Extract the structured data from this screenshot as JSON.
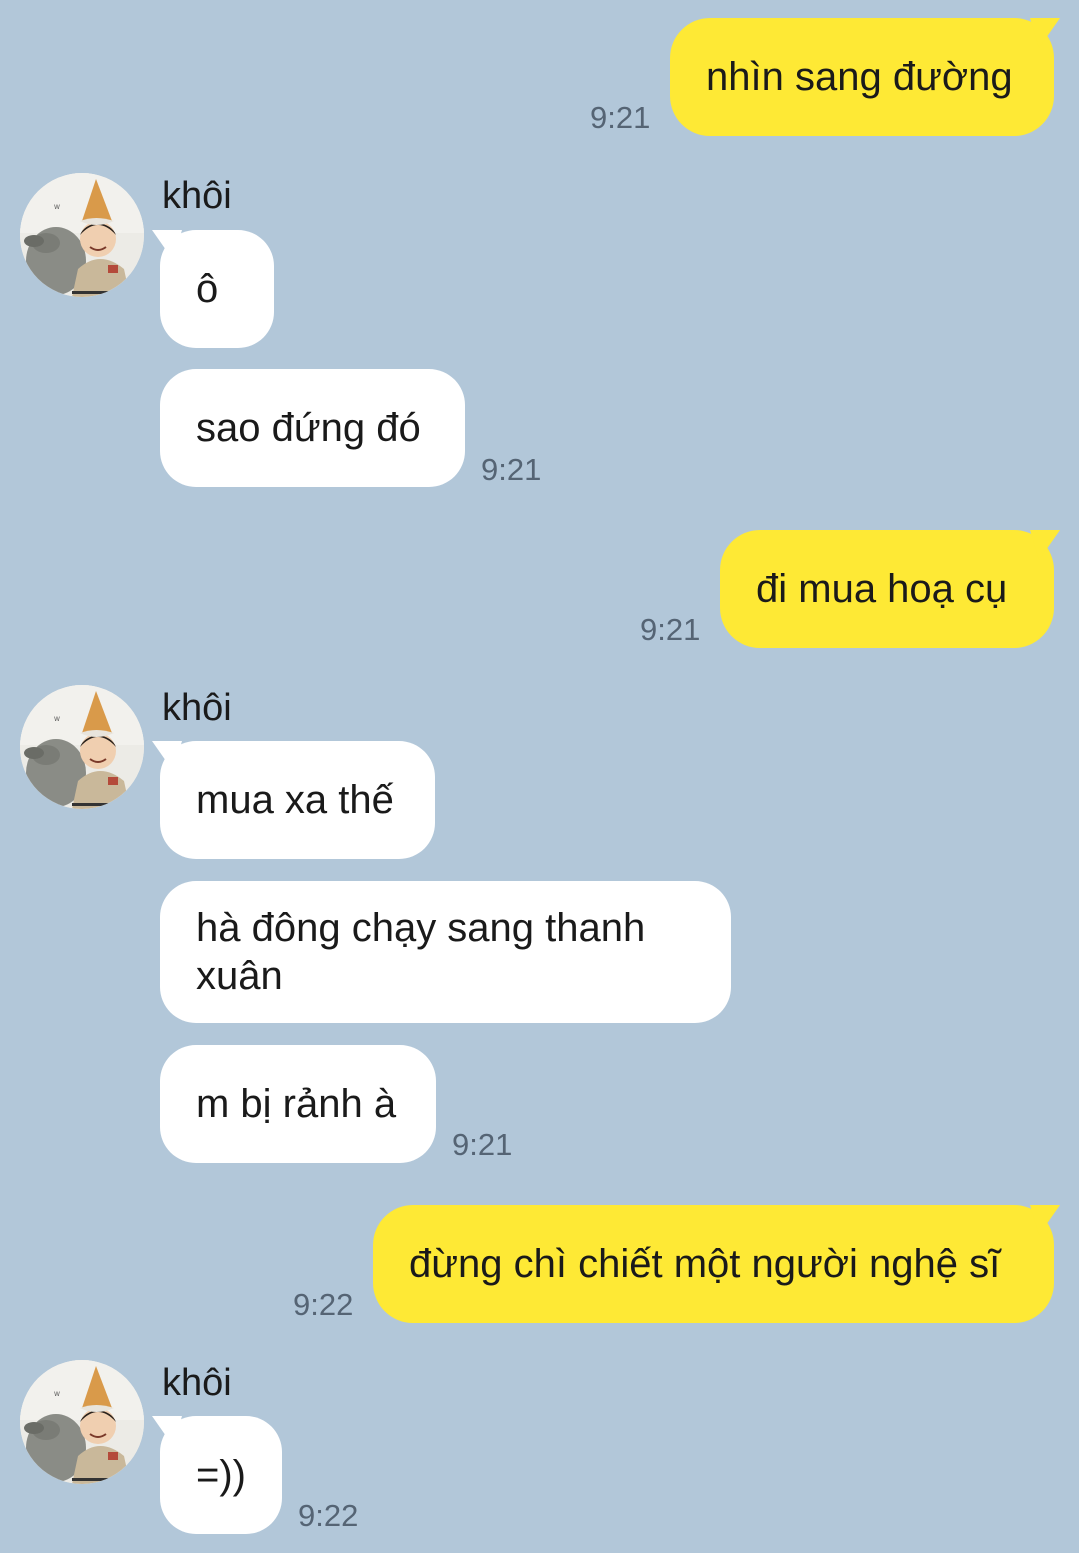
{
  "messages": {
    "m1": {
      "text": "nhìn sang đường",
      "time": "9:21"
    },
    "g1": {
      "sender": "khôi",
      "b1": "ô",
      "b2": "sao đứng đó",
      "time": "9:21"
    },
    "m2": {
      "text": "đi mua hoạ cụ",
      "time": "9:21"
    },
    "g2": {
      "sender": "khôi",
      "b1": "mua xa thế",
      "b2": "hà đông chạy sang thanh xuân",
      "b3": "m bị rảnh à",
      "time": "9:21"
    },
    "m3": {
      "text": "đừng chì chiết một người nghệ sĩ",
      "time": "9:22"
    },
    "g3": {
      "sender": "khôi",
      "b1": "=))",
      "time": "9:22"
    }
  },
  "colors": {
    "background": "#b2c7d9",
    "my_bubble": "#fee935",
    "their_bubble": "#ffffff",
    "time_text": "#556474"
  },
  "icons": {
    "avatar": "profile-photo-child-party-hat-with-alpaca"
  }
}
